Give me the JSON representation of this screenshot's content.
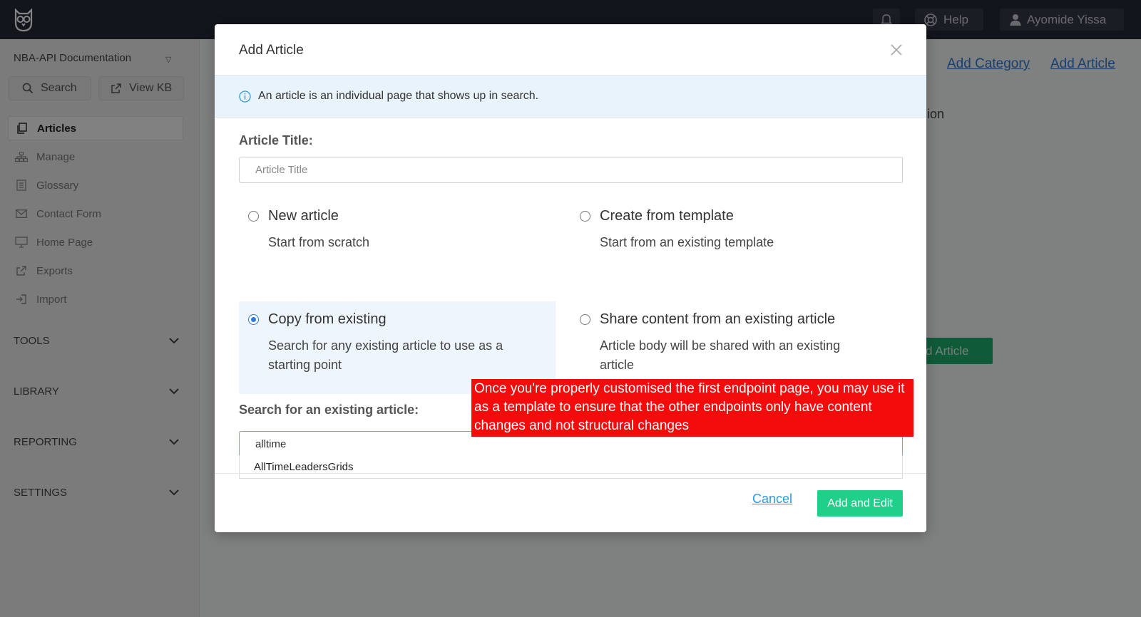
{
  "topbar": {
    "logo_text": "",
    "help_label": "Help",
    "user_name": "Ayomide Yissa"
  },
  "sidebar": {
    "kb_name": "NBA-API Documentation",
    "search_label": "Search",
    "view_kb_label": "View KB",
    "items": [
      {
        "label": "Articles",
        "icon": "articles-icon"
      },
      {
        "label": "Manage",
        "icon": "sitemap-icon"
      },
      {
        "label": "Glossary",
        "icon": "book-icon"
      },
      {
        "label": "Contact Form",
        "icon": "envelope-icon"
      },
      {
        "label": "Home Page",
        "icon": "monitor-icon"
      },
      {
        "label": "Exports",
        "icon": "external-link-icon"
      },
      {
        "label": "Import",
        "icon": "sign-in-icon"
      }
    ],
    "sections": [
      {
        "label": "TOOLS"
      },
      {
        "label": "LIBRARY"
      },
      {
        "label": "REPORTING"
      },
      {
        "label": "SETTINGS"
      }
    ]
  },
  "background": {
    "add_category": "Add Category",
    "add_article": "Add Article",
    "partial_text": "ion",
    "green_button": "d Article"
  },
  "modal": {
    "title": "Add Article",
    "info": "An article is an individual page that shows up in search.",
    "title_label": "Article Title:",
    "title_placeholder": "Article Title",
    "options": [
      {
        "title": "New article",
        "desc": "Start from scratch",
        "checked": false
      },
      {
        "title": "Create from template",
        "desc": "Start from an existing template",
        "checked": false
      },
      {
        "title": "Copy from existing",
        "desc": "Search for any existing article to use as a starting point",
        "checked": true
      },
      {
        "title": "Share content from an existing article",
        "desc": "Article body will be shared with an existing article",
        "checked": false
      }
    ],
    "search_label": "Search for an existing article:",
    "search_value": "alltime",
    "suggestion": "AllTimeLeadersGrids",
    "cancel_label": "Cancel",
    "primary_label": "Add and Edit"
  },
  "annotation": {
    "text": "Once you're properly customised the first endpoint page, you may use it as a template to ensure that the other endpoints only have content changes and not structural changes"
  },
  "colors": {
    "accent_blue": "#2f7ad7",
    "primary_green": "#1fcf8a",
    "annotation_red": "#f40c0c",
    "topbar": "#232a36"
  }
}
